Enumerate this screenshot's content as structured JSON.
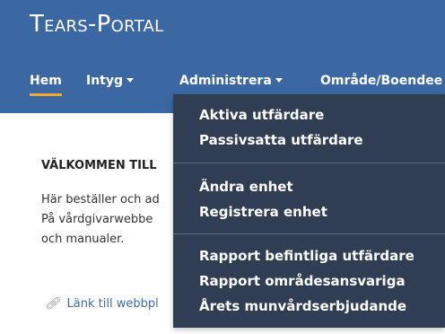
{
  "app": {
    "title": "Tears-Portal"
  },
  "nav": {
    "items": [
      {
        "label": "Hem"
      },
      {
        "label": "Intyg"
      },
      {
        "label": "Administrera"
      },
      {
        "label": "Område/Boendee"
      }
    ]
  },
  "content": {
    "welcome": "VÄLKOMMEN TILL",
    "lines": [
      "Här beställer och ad",
      "På vårdgivarwebbe",
      "och manualer."
    ],
    "link_text": "Länk till webbpl"
  },
  "dropdown": {
    "groups": [
      [
        "Aktiva utfärdare",
        "Passivsatta utfärdare"
      ],
      [
        "Ändra enhet",
        "Registrera enhet"
      ],
      [
        "Rapport befintliga utfärdare",
        "Rapport områdesansvariga",
        "Årets munvårdserbjudande"
      ]
    ]
  },
  "colors": {
    "header_bg": "#3b68a2",
    "dropdown_bg": "#2f3e52",
    "active_underline": "#f0a830",
    "link": "#3a6db0"
  }
}
